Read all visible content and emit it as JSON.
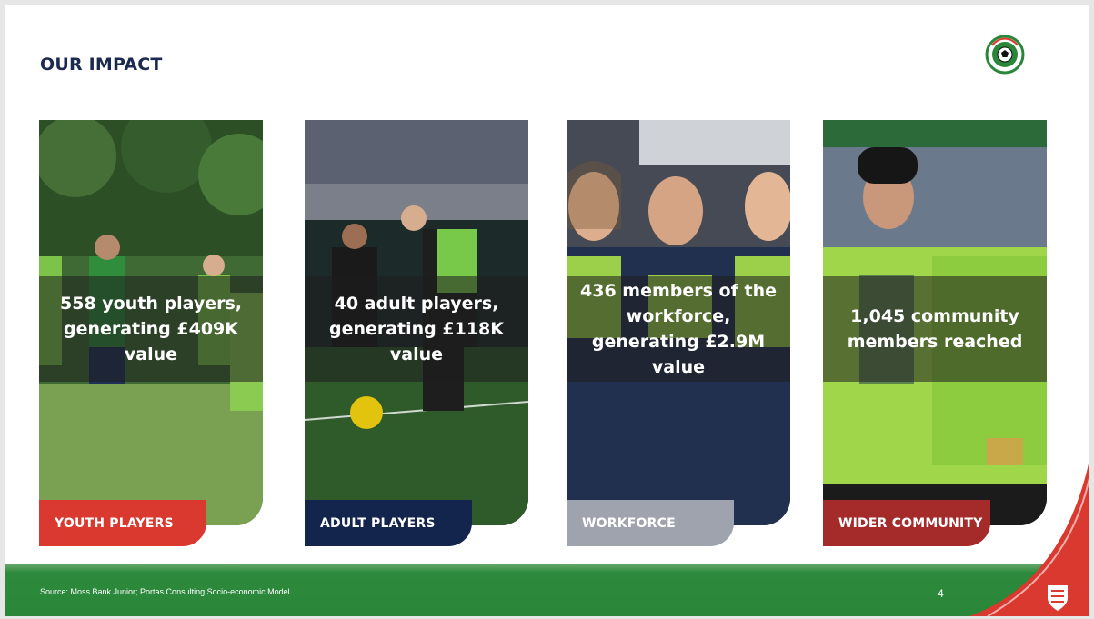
{
  "slide": {
    "title": "OUR IMPACT",
    "source": "Source: Moss Bank Junior; Portas Consulting Socio-economic Model",
    "page_number": "4"
  },
  "cards": [
    {
      "stat": "558 youth players, generating £409K value",
      "label": "YOUTH PLAYERS",
      "label_color": "#d9392f",
      "photo": "youth-players-photo"
    },
    {
      "stat": "40 adult players, generating £118K value",
      "label": "ADULT PLAYERS",
      "label_color": "#14254d",
      "photo": "adult-players-photo"
    },
    {
      "stat": "436 members of the workforce, generating £2.9M value",
      "label": "WORKFORCE",
      "label_color": "#9fa3ae",
      "photo": "workforce-photo"
    },
    {
      "stat": "1,045 community members reached",
      "label": "WIDER COMMUNITY",
      "label_color": "#a52a2a",
      "photo": "wider-community-photo"
    }
  ],
  "colors": {
    "title": "#1d2a4f",
    "footer_green": "#2a8638",
    "corner_red": "#d9392f"
  }
}
